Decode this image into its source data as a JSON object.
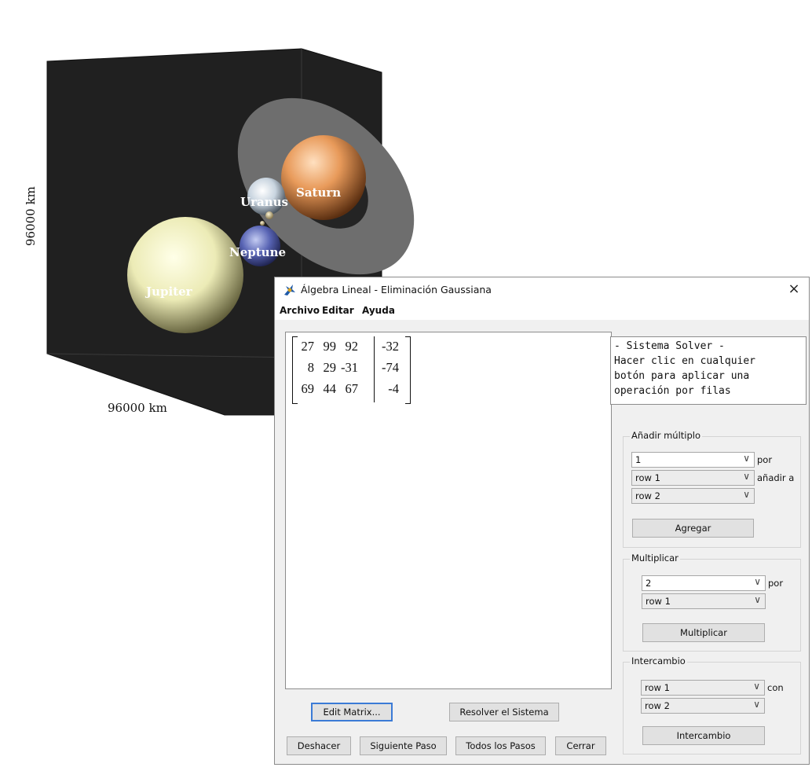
{
  "scene": {
    "axis_labels": {
      "vertical": "96000 km",
      "horizontal": "96000 km"
    },
    "planets": [
      "Saturn",
      "Uranus",
      "Neptune",
      "Jupiter"
    ]
  },
  "dialog": {
    "title": "Álgebra Lineal - Eliminación Gaussiana",
    "close_label": "×",
    "menu": [
      "Archivo",
      "Editar",
      "Ayuda"
    ]
  },
  "matrix": {
    "rows": [
      [
        "27",
        "99",
        "92",
        "-32"
      ],
      [
        "8",
        "29",
        "-31",
        "-74"
      ],
      [
        "69",
        "44",
        "67",
        "-4"
      ]
    ]
  },
  "solver_text": "- Sistema Solver -\nHacer clic en cualquier\nbotón para aplicar una\noperación por filas",
  "add_multiple": {
    "title": "Añadir múltiplo",
    "factor": "1",
    "por_label": "por",
    "source_row": "row 1",
    "add_to_label": "añadir a",
    "target_row": "row 2",
    "button": "Agregar"
  },
  "multiply": {
    "title": "Multiplicar",
    "factor": "2",
    "por_label": "por",
    "row": "row 1",
    "button": "Multiplicar"
  },
  "swap": {
    "title": "Intercambio",
    "row_a": "row 1",
    "con_label": "con",
    "row_b": "row 2",
    "button": "Intercambio"
  },
  "buttons": {
    "edit_matrix": "Edit Matrix...",
    "solve": "Resolver el Sistema",
    "undo": "Deshacer",
    "next_step": "Siguiente Paso",
    "all_steps": "Todos los Pasos",
    "close": "Cerrar"
  },
  "icons": {
    "chevron": "chevron-down-icon",
    "app": "app-icon"
  }
}
